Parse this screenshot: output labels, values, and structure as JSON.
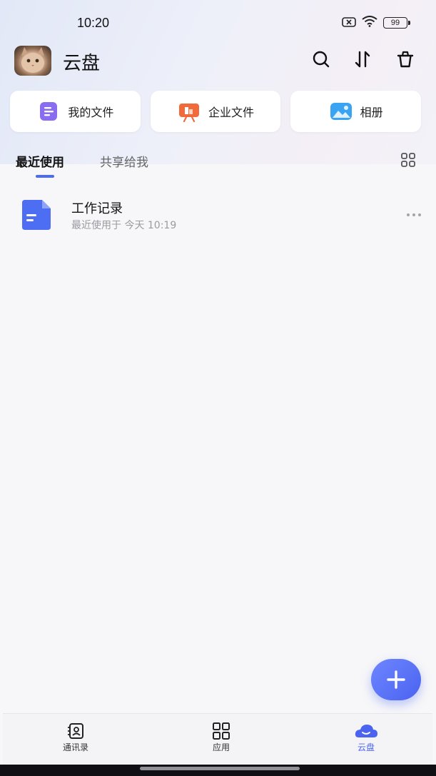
{
  "status_bar": {
    "time": "10:20",
    "battery_level": "99"
  },
  "header": {
    "title": "云盘"
  },
  "quick_access": [
    {
      "label": "我的文件",
      "icon": "document-icon",
      "color": "#8a6cf0"
    },
    {
      "label": "企业文件",
      "icon": "presentation-icon",
      "color": "#f06a3c"
    },
    {
      "label": "相册",
      "icon": "photo-album-icon",
      "color": "#3aa3f2"
    }
  ],
  "tabs": [
    {
      "label": "最近使用",
      "active": true
    },
    {
      "label": "共享给我",
      "active": false
    }
  ],
  "files": [
    {
      "name": "工作记录",
      "meta": "最近使用于 今天 10:19",
      "icon": "doc-file-icon",
      "color": "#4d6df2"
    }
  ],
  "fab": {
    "label": "+"
  },
  "bottom_nav": [
    {
      "label": "通讯录",
      "icon": "contacts-icon",
      "active": false
    },
    {
      "label": "应用",
      "icon": "apps-grid-icon",
      "active": false
    },
    {
      "label": "云盘",
      "icon": "cloud-icon",
      "active": true
    }
  ],
  "colors": {
    "accent": "#4a63f0"
  }
}
